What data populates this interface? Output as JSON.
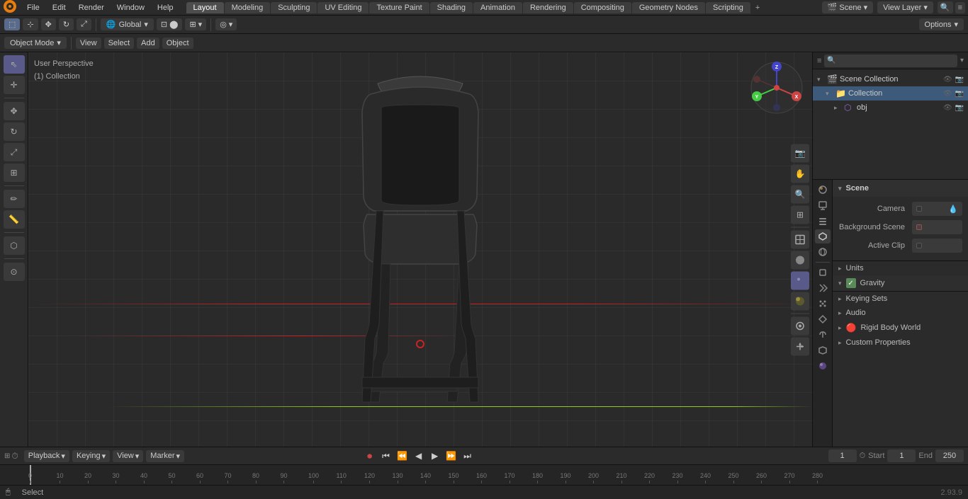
{
  "app": {
    "title": "Blender",
    "version": "2.93.9"
  },
  "top_menu": {
    "items": [
      "File",
      "Edit",
      "Render",
      "Window",
      "Help"
    ],
    "workspaces": [
      "Layout",
      "Modeling",
      "Sculpting",
      "UV Editing",
      "Texture Paint",
      "Shading",
      "Animation",
      "Rendering",
      "Compositing",
      "Geometry Nodes",
      "Scripting"
    ],
    "active_workspace": "Layout",
    "scene_label": "Scene",
    "view_layer_label": "View Layer"
  },
  "header_toolbar": {
    "mode_label": "Object Mode",
    "viewport_shading": "Global",
    "transform_pivot": "Individual Origins",
    "snap_label": "Snap",
    "proportional_label": "Proportional Editing",
    "options_label": "Options"
  },
  "second_toolbar": {
    "items": [
      "Object Mode",
      "View",
      "Select",
      "Add",
      "Object"
    ]
  },
  "left_tools": {
    "tools": [
      "select",
      "move",
      "rotate",
      "scale",
      "transform",
      "separator",
      "annotate",
      "measure",
      "separator",
      "add",
      "separator",
      "origin"
    ]
  },
  "viewport": {
    "info": {
      "perspective": "User Perspective",
      "collection": "(1) Collection"
    }
  },
  "viewport_right_tools": {
    "tools": [
      "camera",
      "hand",
      "magnify",
      "grid",
      "separator",
      "wireframe",
      "material",
      "rendered",
      "separator",
      "overlay",
      "gizmo"
    ]
  },
  "outliner": {
    "title": "Outliner",
    "search_placeholder": "",
    "scene_collection": "Scene Collection",
    "collection": "Collection",
    "obj": "obj"
  },
  "properties": {
    "tabs": [
      "scene",
      "world",
      "object",
      "modifier",
      "particles",
      "physics",
      "constraints",
      "data",
      "material",
      "render",
      "output",
      "view_layer",
      "compositor"
    ],
    "active_tab": "scene",
    "scene_section": {
      "title": "Scene",
      "camera_label": "Camera",
      "camera_value": "",
      "background_scene_label": "Background Scene",
      "background_scene_value": "",
      "active_clip_label": "Active Clip",
      "active_clip_value": ""
    },
    "units_label": "Units",
    "gravity_label": "Gravity",
    "gravity_enabled": true,
    "keying_sets_label": "Keying Sets",
    "audio_label": "Audio",
    "rigid_body_world_label": "Rigid Body World",
    "custom_properties_label": "Custom Properties"
  },
  "timeline": {
    "playback_label": "Playback",
    "keying_label": "Keying",
    "view_label": "View",
    "marker_label": "Marker",
    "current_frame": "1",
    "start_label": "Start",
    "start_value": "1",
    "end_label": "End",
    "end_value": "250",
    "ruler_marks": [
      "0",
      "10",
      "20",
      "30",
      "40",
      "50",
      "60",
      "70",
      "80",
      "90",
      "100",
      "110",
      "120",
      "130",
      "140",
      "150",
      "160",
      "170",
      "180",
      "190",
      "200",
      "210",
      "220",
      "230",
      "240",
      "250",
      "260",
      "270",
      "280"
    ]
  },
  "status_bar": {
    "select_label": "Select",
    "key_icon": "x",
    "version": "2.93.9"
  }
}
